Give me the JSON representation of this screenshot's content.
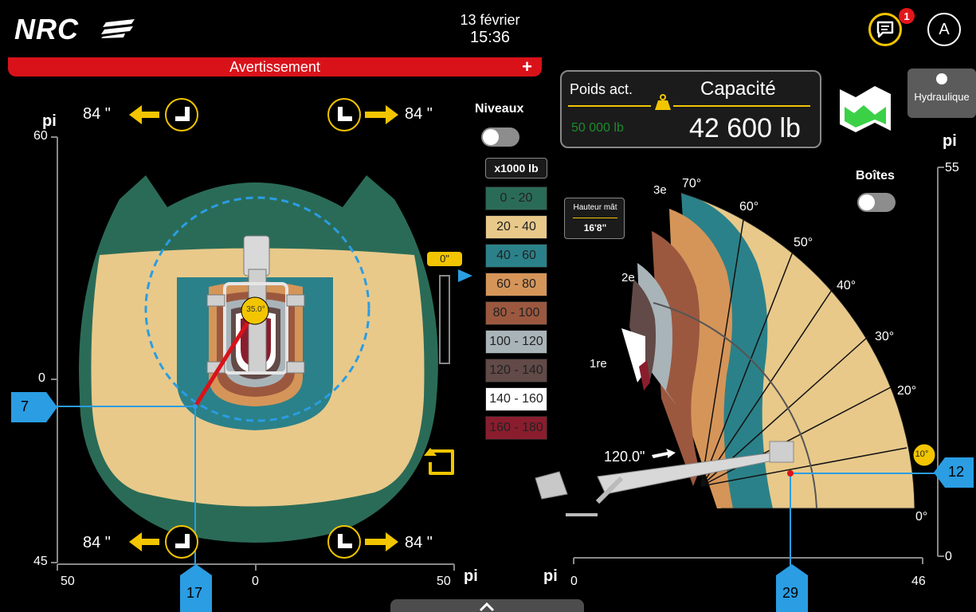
{
  "header": {
    "logo": "NRC",
    "date": "13 février",
    "time": "15:36",
    "notification_count": "1",
    "user_initial": "A"
  },
  "warning": {
    "label": "Avertissement",
    "plus": "+"
  },
  "weight": {
    "current_label": "Poids act.",
    "current_value": "50 000 lb",
    "capacity_label": "Capacité",
    "capacity_value": "42 600 lb"
  },
  "hydraulic": {
    "label": "Hydraulique"
  },
  "levels": {
    "label": "Niveaux",
    "toggle_on": false
  },
  "boxes": {
    "label": "Boîtes",
    "toggle_on": false
  },
  "legend": {
    "header": "x1000 lb",
    "items": [
      {
        "label": "0 - 20",
        "color": "#2a6b57",
        "text_color": "#222"
      },
      {
        "label": "20 - 40",
        "color": "#e8c98a",
        "text_color": "#222"
      },
      {
        "label": "40 - 60",
        "color": "#2b8189",
        "text_color": "#222"
      },
      {
        "label": "60 - 80",
        "color": "#d59559",
        "text_color": "#222"
      },
      {
        "label": "80 - 100",
        "color": "#9b583f",
        "text_color": "#222"
      },
      {
        "label": "100 - 120",
        "color": "#a9b4b9",
        "text_color": "#222"
      },
      {
        "label": "120 - 140",
        "color": "#614a47",
        "text_color": "#222"
      },
      {
        "label": "140 - 160",
        "color": "#ffffff",
        "text_color": "#222"
      },
      {
        "label": "160 - 180",
        "color": "#8a1d2d",
        "text_color": "#222"
      }
    ]
  },
  "top_view": {
    "unit_left": "pi",
    "unit_bottom": "pi",
    "y_ticks": [
      "60",
      "0",
      "45"
    ],
    "x_ticks": [
      "50",
      "0",
      "50"
    ],
    "outrigger_labels": [
      "84 \"",
      "84 \"",
      "84 \"",
      "84 \""
    ],
    "angle": "35.0°",
    "marker_left": "7",
    "marker_bottom": "17",
    "height_indicator": "0\""
  },
  "side_view": {
    "unit_right": "pi",
    "unit_bottom": "pi",
    "y_ticks": [
      "55",
      "0"
    ],
    "x_ticks": [
      "0",
      "46"
    ],
    "angle_labels": [
      "70°",
      "60°",
      "50°",
      "40°",
      "30°",
      "20°",
      "10°",
      "0°"
    ],
    "section_labels": [
      "3e",
      "2e",
      "1re"
    ],
    "boom_angle": "10°",
    "mast_height_label": "Hauteur mât",
    "mast_height_value": "16'8\"",
    "extension_label": "120.0\"",
    "marker_right": "12",
    "marker_bottom": "29"
  },
  "colors": {
    "accent_yellow": "#f2c500",
    "warning_red": "#d9121a",
    "marker_blue": "#2a9de3"
  }
}
